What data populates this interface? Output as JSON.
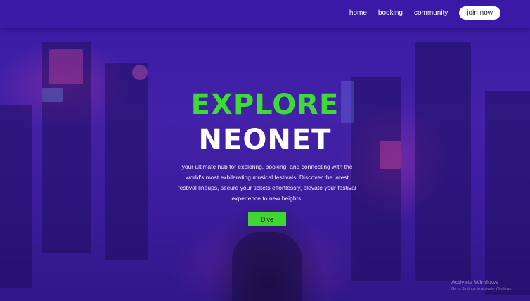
{
  "nav": {
    "items": [
      {
        "label": "home"
      },
      {
        "label": "booking"
      },
      {
        "label": "community"
      }
    ],
    "cta_label": "join now"
  },
  "hero": {
    "title_line1": "EXPLORE",
    "title_line2": "NEONET",
    "description": "your ultimate hub for exploring, booking, and connecting with the world's most exhilarating musical festivals. Discover the latest festival lineups, secure your tickets effortlessly, elevate your festival experience to new heights.",
    "button_label": "Dive"
  },
  "watermark": {
    "title": "Activate Windows",
    "subtitle": "Go to Settings to activate Windows."
  },
  "colors": {
    "background": "#3a1a9e",
    "header": "#3a19a6",
    "accent_green": "#3ddc35",
    "text_white": "#ffffff"
  }
}
